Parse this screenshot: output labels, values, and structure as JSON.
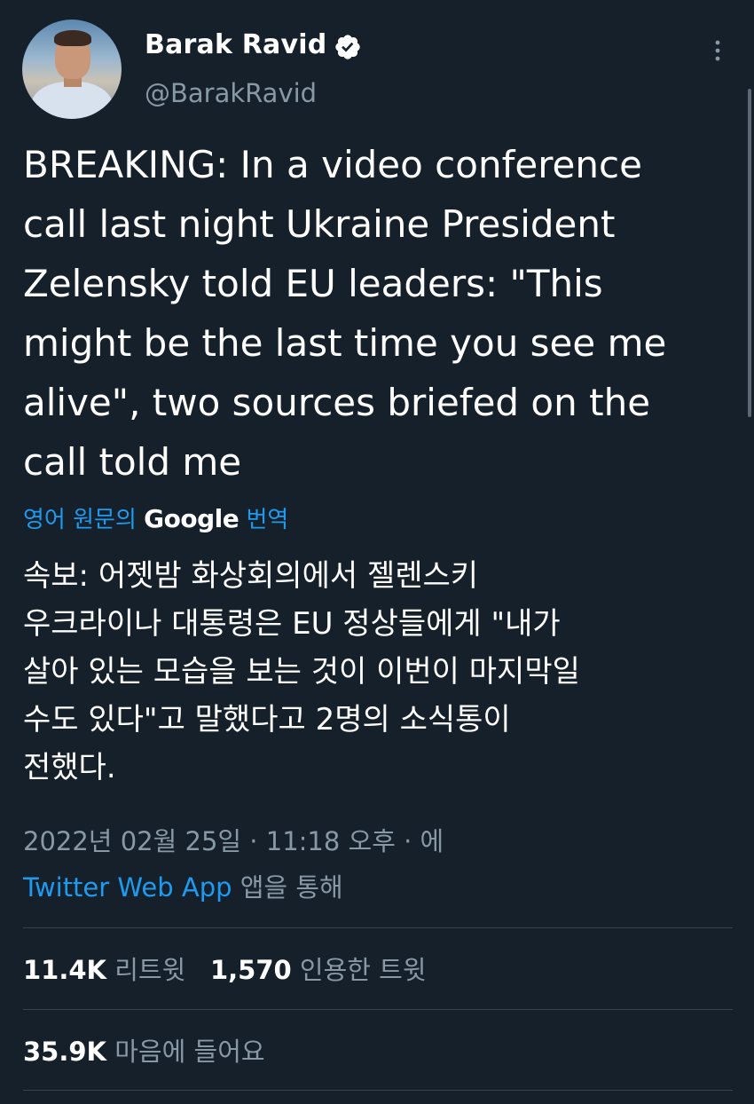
{
  "author": {
    "display_name": "Barak Ravid",
    "handle": "@BarakRavid",
    "verified_icon": "verified-badge-icon"
  },
  "tweet": {
    "text": "BREAKING: In a video conference\ncall last night Ukraine President\nZelensky told EU leaders: \"This\nmight be the last time you see me\nalive\", two sources briefed on the\ncall told me",
    "translate_prefix": "영어 원문의",
    "translate_brand": "Google",
    "translate_suffix": "번역",
    "translated_text": "속보: 어젯밤 화상회의에서 젤렌스키\n우크라이나 대통령은 EU 정상들에게 \"내가\n살아 있는 모습을 보는 것이 이번이 마지막일\n수도 있다\"고 말했다고 2명의 소식통이\n전했다.",
    "timestamp": "2022년 02월 25일 · 11:18 오후 · 에",
    "source_app": "Twitter Web App",
    "source_suffix": "앱을 통해"
  },
  "stats": {
    "retweets_count": "11.4K",
    "retweets_label": "리트윗",
    "quotes_count": "1,570",
    "quotes_label": "인용한 트윗",
    "likes_count": "35.9K",
    "likes_label": "마음에 들어요"
  },
  "colors": {
    "background": "#15202b",
    "link": "#1d9bf0",
    "secondary_text": "#8899a6",
    "divider": "#38444d"
  },
  "icons": {
    "more": "more-vertical-icon"
  }
}
